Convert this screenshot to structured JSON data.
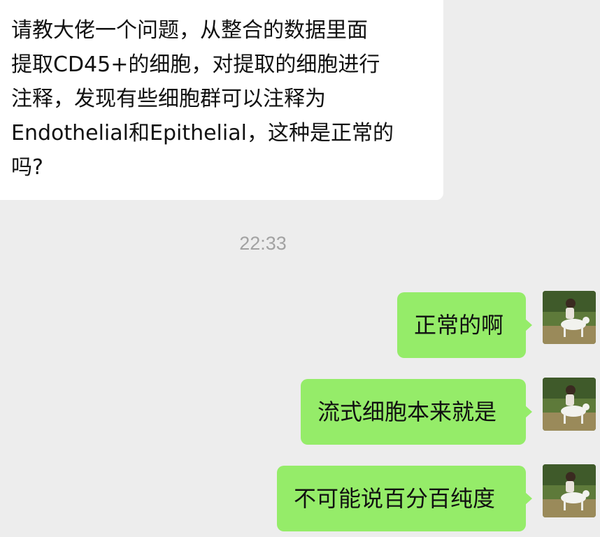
{
  "incoming_message": {
    "text": "请教大佬一个问题，从整合的数据里面\n提取CD45+的细胞，对提取的细胞进行\n注释，发现有些细胞群可以注释为\nEndothelial和Epithelial，这种是正常的\n吗?"
  },
  "timestamp": "22:33",
  "outgoing_messages": [
    {
      "text": "正常的啊",
      "avatar": "user-avatar-photo"
    },
    {
      "text": "流式细胞本来就是",
      "avatar": "user-avatar-photo"
    },
    {
      "text": "不可能说百分百纯度",
      "avatar": "user-avatar-photo"
    }
  ],
  "colors": {
    "background": "#EDEDED",
    "incoming_bubble": "#FFFFFF",
    "outgoing_bubble": "#95EC69",
    "timestamp_text": "#A2A2A2"
  }
}
